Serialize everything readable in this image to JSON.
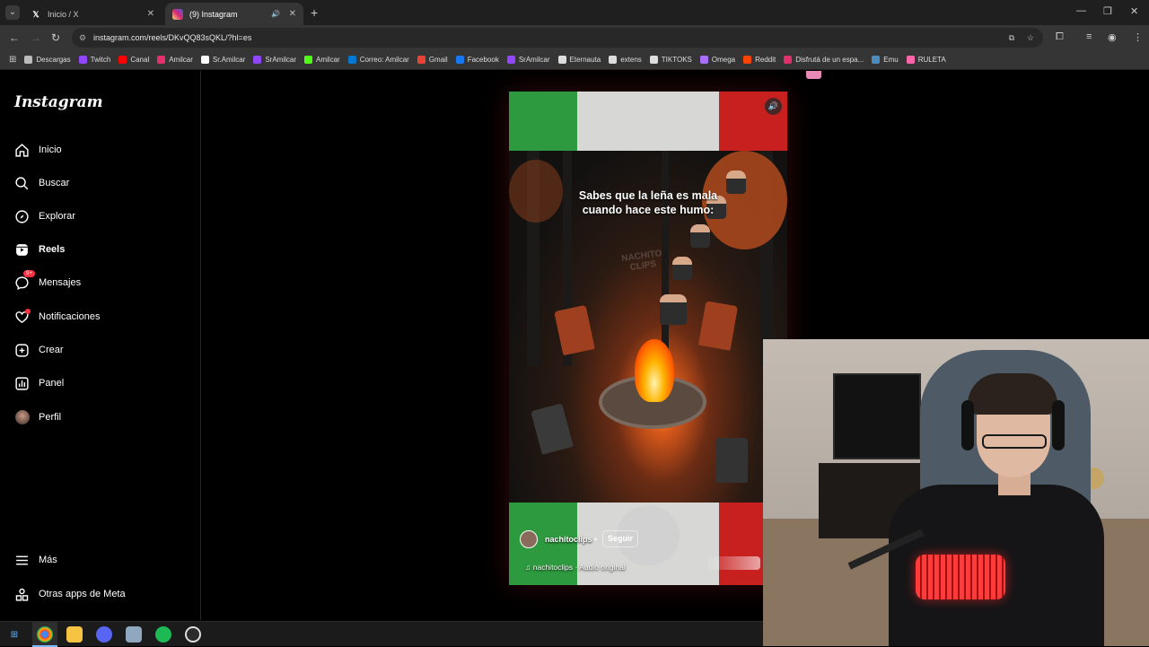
{
  "browser": {
    "tabs": [
      {
        "title": "Inicio / X",
        "icon": "x-logo-icon",
        "active": false
      },
      {
        "title": "(9) Instagram",
        "icon": "instagram-icon",
        "active": true
      }
    ],
    "url": "instagram.com/reels/DKvQQ83sQKL/?hl=es",
    "bookmarks": [
      {
        "label": "Descargas",
        "color": "#bbbbbb"
      },
      {
        "label": "Twitch",
        "color": "#9146ff"
      },
      {
        "label": "Canal",
        "color": "#ff0000"
      },
      {
        "label": "Amilcar",
        "color": "#e1306c"
      },
      {
        "label": "Sr.Amilcar",
        "color": "#ffffff"
      },
      {
        "label": "SrAmilcar",
        "color": "#9146ff"
      },
      {
        "label": "Amilcar",
        "color": "#53fc18"
      },
      {
        "label": "Correo: Amilcar",
        "color": "#0078d4"
      },
      {
        "label": "Gmail",
        "color": "#ea4335"
      },
      {
        "label": "Facebook",
        "color": "#1877f2"
      },
      {
        "label": "SrAmilcar",
        "color": "#9146ff"
      },
      {
        "label": "Eternauta",
        "color": "#dddddd"
      },
      {
        "label": "extens",
        "color": "#dddddd"
      },
      {
        "label": "TIKTOKS",
        "color": "#dddddd"
      },
      {
        "label": "Omega",
        "color": "#a970ff"
      },
      {
        "label": "Reddit",
        "color": "#ff4500"
      },
      {
        "label": "Disfrutá de un espa...",
        "color": "#e1306c"
      },
      {
        "label": "Emu",
        "color": "#4b8bbe"
      },
      {
        "label": "RULETA",
        "color": "#ff66aa"
      }
    ]
  },
  "instagram": {
    "logo": "Instagram",
    "nav": [
      {
        "label": "Inicio",
        "icon": "home-icon"
      },
      {
        "label": "Buscar",
        "icon": "search-icon"
      },
      {
        "label": "Explorar",
        "icon": "compass-icon"
      },
      {
        "label": "Reels",
        "icon": "reels-icon"
      },
      {
        "label": "Mensajes",
        "icon": "messenger-icon",
        "badge": "9+"
      },
      {
        "label": "Notificaciones",
        "icon": "heart-icon"
      },
      {
        "label": "Crear",
        "icon": "plus-square-icon"
      },
      {
        "label": "Panel",
        "icon": "bar-chart-icon"
      },
      {
        "label": "Perfil",
        "icon": "avatar-icon"
      }
    ],
    "bottom_nav": [
      {
        "label": "Más",
        "icon": "menu-icon"
      },
      {
        "label": "Otras apps de Meta",
        "icon": "meta-apps-icon"
      }
    ]
  },
  "reel": {
    "caption_line1": "Sabes que la leña es mala",
    "caption_line2": "cuando hace este humo:",
    "watermark_line1": "NACHITO",
    "watermark_line2": "CLIPS",
    "username": "nachitoclips",
    "separator": "•",
    "follow_label": "Seguir",
    "audio": "nachitoclips · Audio original"
  }
}
